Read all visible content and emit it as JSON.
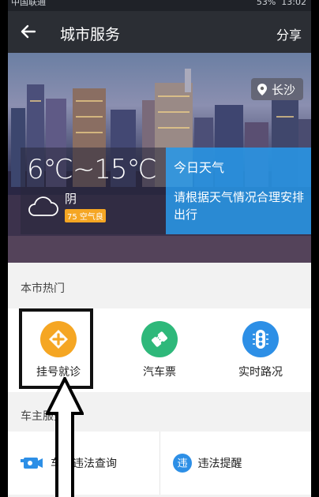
{
  "status_bar": {
    "carrier": "中国联通",
    "signal_info": "53%",
    "time": "13:02"
  },
  "nav": {
    "title": "城市服务",
    "share_label": "分享"
  },
  "location": {
    "city": "长沙"
  },
  "weather": {
    "temperature": "6℃~15℃",
    "condition": "阴",
    "aqi": "75 空气良"
  },
  "tip": {
    "title": "今日天气",
    "text": "请根据天气情况合理安排出行"
  },
  "hot_section": {
    "title": "本市热门"
  },
  "hot_services": [
    {
      "label": "挂号就诊",
      "icon": "medical-cross-icon",
      "color": "#f5a623"
    },
    {
      "label": "汽车票",
      "icon": "ticket-icon",
      "color": "#2eb87a"
    },
    {
      "label": "实时路况",
      "icon": "traffic-light-icon",
      "color": "#2d8fe6"
    }
  ],
  "owner_section": {
    "title": "车主服务"
  },
  "owner_services": [
    {
      "label": "车辆违法查询",
      "icon": "car-camera-icon",
      "color": "#2d8fe6"
    },
    {
      "label": "违法提醒",
      "icon": "violation-badge-icon",
      "badge": "违",
      "color": "#2d8fe6"
    }
  ]
}
